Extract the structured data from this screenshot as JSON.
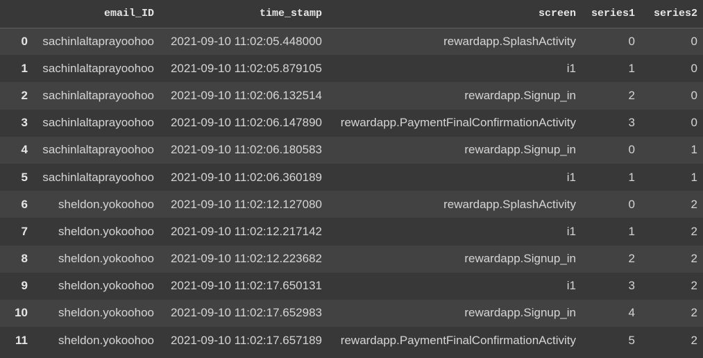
{
  "table": {
    "columns": [
      "",
      "email_ID",
      "time_stamp",
      "screen",
      "series1",
      "series2"
    ],
    "rows": [
      {
        "index": "0",
        "email_ID": "sachinlaltaprayoohoo",
        "time_stamp": "2021-09-10 11:02:05.448000",
        "screen": "rewardapp.SplashActivity",
        "series1": "0",
        "series2": "0"
      },
      {
        "index": "1",
        "email_ID": "sachinlaltaprayoohoo",
        "time_stamp": "2021-09-10 11:02:05.879105",
        "screen": "i1",
        "series1": "1",
        "series2": "0"
      },
      {
        "index": "2",
        "email_ID": "sachinlaltaprayoohoo",
        "time_stamp": "2021-09-10 11:02:06.132514",
        "screen": "rewardapp.Signup_in",
        "series1": "2",
        "series2": "0"
      },
      {
        "index": "3",
        "email_ID": "sachinlaltaprayoohoo",
        "time_stamp": "2021-09-10 11:02:06.147890",
        "screen": "rewardapp.PaymentFinalConfirmationActivity",
        "series1": "3",
        "series2": "0"
      },
      {
        "index": "4",
        "email_ID": "sachinlaltaprayoohoo",
        "time_stamp": "2021-09-10 11:02:06.180583",
        "screen": "rewardapp.Signup_in",
        "series1": "0",
        "series2": "1"
      },
      {
        "index": "5",
        "email_ID": "sachinlaltaprayoohoo",
        "time_stamp": "2021-09-10 11:02:06.360189",
        "screen": "i1",
        "series1": "1",
        "series2": "1"
      },
      {
        "index": "6",
        "email_ID": "sheldon.yokoohoo",
        "time_stamp": "2021-09-10 11:02:12.127080",
        "screen": "rewardapp.SplashActivity",
        "series1": "0",
        "series2": "2"
      },
      {
        "index": "7",
        "email_ID": "sheldon.yokoohoo",
        "time_stamp": "2021-09-10 11:02:12.217142",
        "screen": "i1",
        "series1": "1",
        "series2": "2"
      },
      {
        "index": "8",
        "email_ID": "sheldon.yokoohoo",
        "time_stamp": "2021-09-10 11:02:12.223682",
        "screen": "rewardapp.Signup_in",
        "series1": "2",
        "series2": "2"
      },
      {
        "index": "9",
        "email_ID": "sheldon.yokoohoo",
        "time_stamp": "2021-09-10 11:02:17.650131",
        "screen": "i1",
        "series1": "3",
        "series2": "2"
      },
      {
        "index": "10",
        "email_ID": "sheldon.yokoohoo",
        "time_stamp": "2021-09-10 11:02:17.652983",
        "screen": "rewardapp.Signup_in",
        "series1": "4",
        "series2": "2"
      },
      {
        "index": "11",
        "email_ID": "sheldon.yokoohoo",
        "time_stamp": "2021-09-10 11:02:17.657189",
        "screen": "rewardapp.PaymentFinalConfirmationActivity",
        "series1": "5",
        "series2": "2"
      }
    ]
  },
  "colors": {
    "background": "#383838",
    "row_alt": "#424242",
    "text": "#d5d5d5",
    "header_text": "#e6e6e6"
  }
}
